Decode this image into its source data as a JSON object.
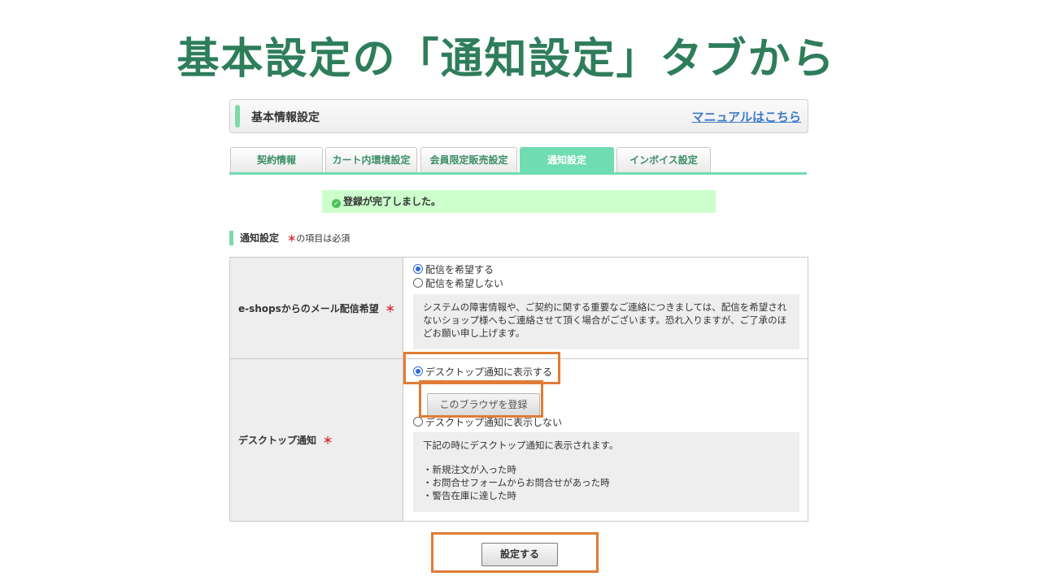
{
  "slide": {
    "title": "基本設定の「通知設定」タブから"
  },
  "header": {
    "title": "基本情報設定",
    "manual_link": "マニュアルはこちら"
  },
  "tabs": [
    {
      "label": "契約情報",
      "active": false
    },
    {
      "label": "カート内環境設定",
      "active": false
    },
    {
      "label": "会員限定販売設定",
      "active": false
    },
    {
      "label": "通知設定",
      "active": true
    },
    {
      "label": "インボイス設定",
      "active": false
    }
  ],
  "success_message": "登録が完了しました。",
  "section": {
    "title": "通知設定",
    "required_mark": "＊",
    "required_note": "の項目は必須"
  },
  "mail_setting": {
    "label": "e-shopsからのメール配信希望",
    "required_mark": "＊",
    "options": [
      {
        "label": "配信を希望する",
        "checked": true
      },
      {
        "label": "配信を希望しない",
        "checked": false
      }
    ],
    "note": "システムの障害情報や、ご契約に関する重要なご連絡につきましては、配信を希望されないショップ様へもご連絡させて頂く場合がございます。恐れ入りますが、ご了承のほどお願い申し上げます。"
  },
  "desktop_setting": {
    "label": "デスクトップ通知",
    "required_mark": "＊",
    "options": [
      {
        "label": "デスクトップ通知に表示する",
        "checked": true
      },
      {
        "label": "デスクトップ通知に表示しない",
        "checked": false
      }
    ],
    "register_button": "このブラウザを登録",
    "note_intro": "下記の時にデスクトップ通知に表示されます。",
    "note_items": [
      "・新規注文が入った時",
      "・お問合せフォームからお問合せがあった時",
      "・警告在庫に達した時"
    ]
  },
  "submit_button": "設定する",
  "colors": {
    "title_green": "#2e7d5b",
    "tab_active": "#6fdcb2",
    "success_bg": "#ccffcc",
    "link_blue": "#3b7ac7",
    "highlight_orange": "#e07c35",
    "required_red": "#dd2233"
  }
}
